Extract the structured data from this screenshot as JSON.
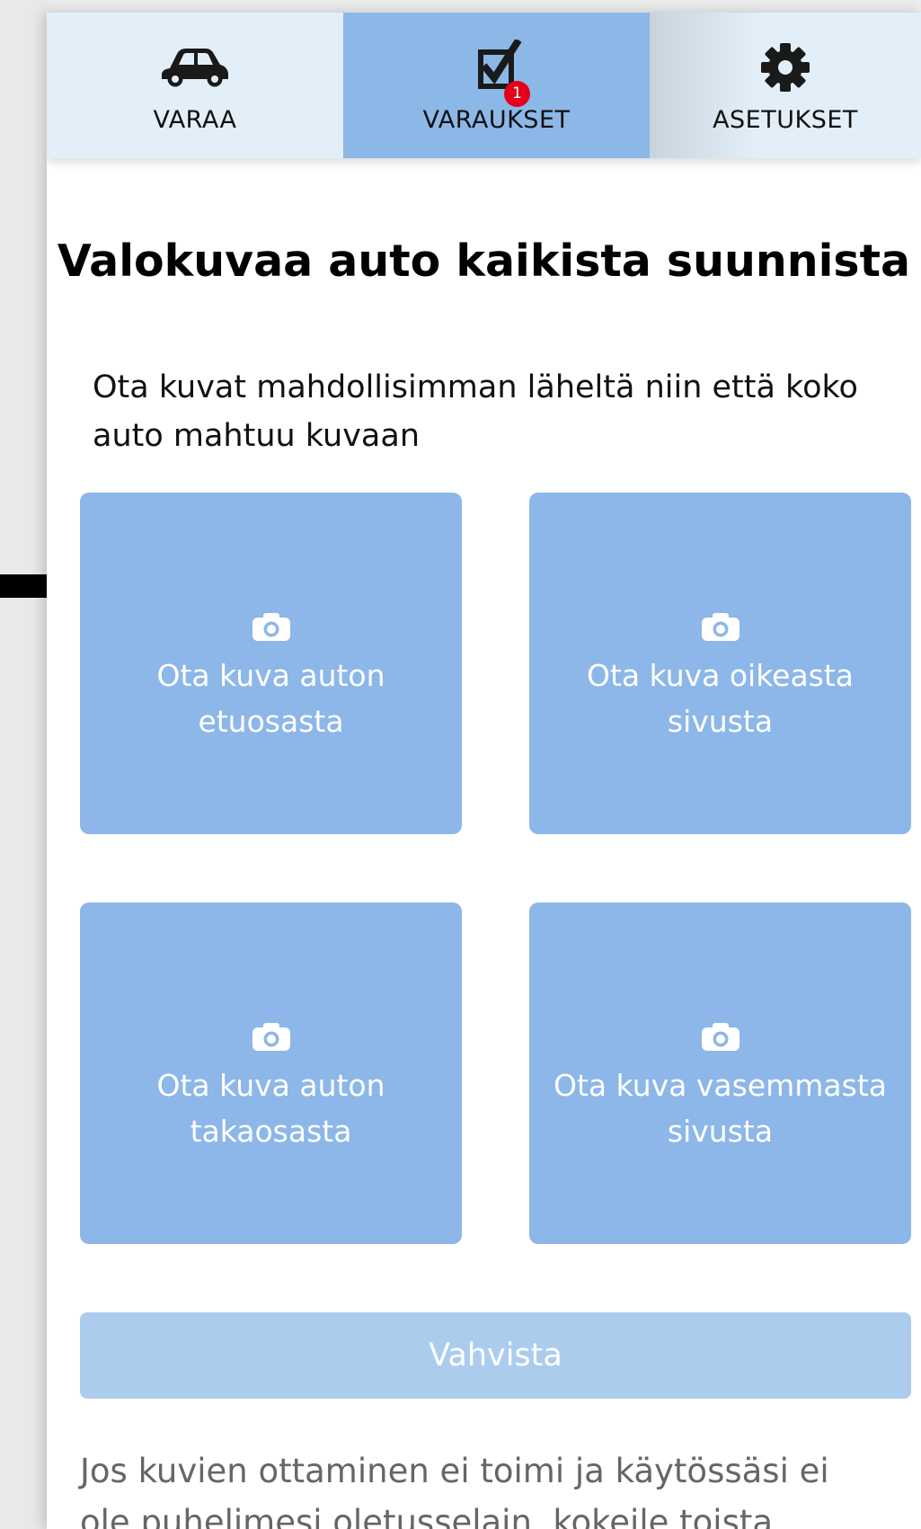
{
  "nav": {
    "tabs": [
      {
        "label": "VARAA",
        "icon": "car-icon",
        "active": false
      },
      {
        "label": "VARAUKSET",
        "icon": "checkbox-icon",
        "active": true,
        "badge": "1"
      },
      {
        "label": "ASETUKSET",
        "icon": "gear-icon",
        "active": false
      }
    ]
  },
  "main": {
    "title": "Valokuvaa auto kaikista suunnista",
    "subtitle": "Ota kuvat mahdollisimman läheltä niin että koko auto mahtuu kuvaan",
    "photo_buttons": [
      {
        "label": "Ota kuva auton etuosasta",
        "icon": "camera-icon"
      },
      {
        "label": "Ota kuva oikeasta sivusta",
        "icon": "camera-icon"
      },
      {
        "label": "Ota kuva auton takaosasta",
        "icon": "camera-icon"
      },
      {
        "label": "Ota kuva vasemmasta sivusta",
        "icon": "camera-icon"
      }
    ],
    "confirm_label": "Vahvista",
    "footer_note": "Jos kuvien ottaminen ei toimi ja käytössäsi ei ole puhelimesi oletusselain, kokeile toista selainta."
  },
  "colors": {
    "accent": "#8cb8e8",
    "tab_inactive": "#e2eff9",
    "confirm_disabled": "#acccee",
    "badge": "#e4001b"
  }
}
